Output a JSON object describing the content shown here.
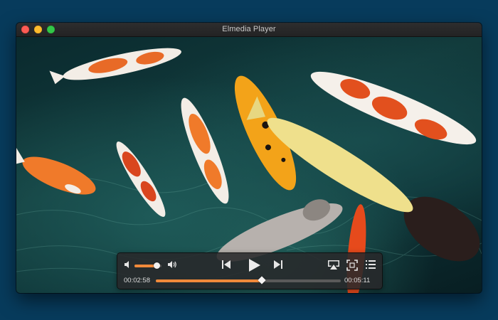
{
  "window": {
    "title": "Elmedia Player"
  },
  "video": {
    "description_icon": "koi-pond-video-frame"
  },
  "controls": {
    "volume_level": 0.82,
    "elapsed": "00:02:58",
    "total": "00:05:11",
    "progress": 0.572
  },
  "colors": {
    "accent": "#f0893a",
    "desktop": "#073b5c",
    "panel": "#28282a"
  }
}
